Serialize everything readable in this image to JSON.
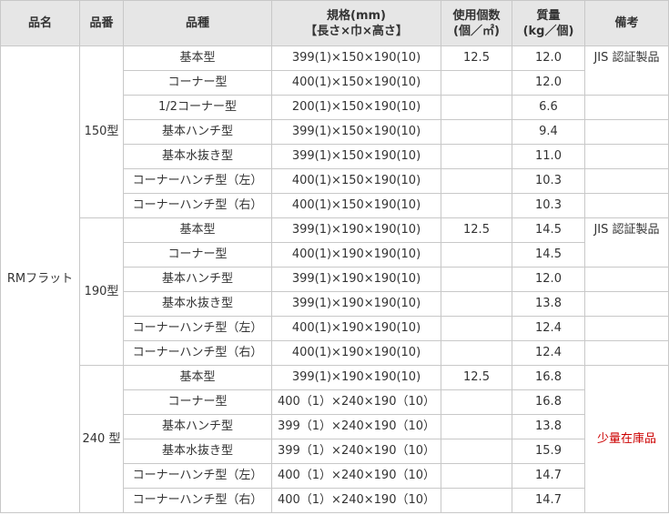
{
  "headers": {
    "name": "品名",
    "number": "品番",
    "type": "品種",
    "spec_line1": "規格(mm)",
    "spec_line2": "【長さ×巾×高さ】",
    "usage_line1": "使用個数",
    "usage_line2": "(個／㎡)",
    "weight_line1": "質量",
    "weight_line2": "(kg／個)",
    "remarks": "備考"
  },
  "product_name": "RMフラット",
  "groups": [
    {
      "number": "150型",
      "usage": "12.5",
      "remark": "JIS 認証製品",
      "rows": [
        {
          "type": "基本型",
          "spec": "399(1)×150×190(10)",
          "weight": "12.0"
        },
        {
          "type": "コーナー型",
          "spec": "400(1)×150×190(10)",
          "weight": "12.0"
        },
        {
          "type": "1/2コーナー型",
          "spec": "200(1)×150×190(10)",
          "weight": "6.6"
        },
        {
          "type": "基本ハンチ型",
          "spec": "399(1)×150×190(10)",
          "weight": "9.4"
        },
        {
          "type": "基本水抜き型",
          "spec": "399(1)×150×190(10)",
          "weight": "11.0"
        },
        {
          "type": "コーナーハンチ型（左）",
          "spec": "400(1)×150×190(10)",
          "weight": "10.3"
        },
        {
          "type": "コーナーハンチ型（右）",
          "spec": "400(1)×150×190(10)",
          "weight": "10.3"
        }
      ]
    },
    {
      "number": "190型",
      "usage": "12.5",
      "remark": "JIS 認証製品",
      "rows": [
        {
          "type": "基本型",
          "spec": "399(1)×190×190(10)",
          "weight": "14.5"
        },
        {
          "type": "コーナー型",
          "spec": "400(1)×190×190(10)",
          "weight": "14.5"
        },
        {
          "type": "基本ハンチ型",
          "spec": "399(1)×190×190(10)",
          "weight": "12.0"
        },
        {
          "type": "基本水抜き型",
          "spec": "399(1)×190×190(10)",
          "weight": "13.8"
        },
        {
          "type": "コーナーハンチ型（左）",
          "spec": "400(1)×190×190(10)",
          "weight": "12.4"
        },
        {
          "type": "コーナーハンチ型（右）",
          "spec": "400(1)×190×190(10)",
          "weight": "12.4"
        }
      ]
    },
    {
      "number": "240 型",
      "usage": "12.5",
      "remark": "少量在庫品",
      "remark_color": "#cc0000",
      "rows": [
        {
          "type": "基本型",
          "spec": "399(1)×190×190(10)",
          "weight": "16.8"
        },
        {
          "type": "コーナー型",
          "spec": "400（1）×240×190（10）",
          "weight": "16.8"
        },
        {
          "type": "基本ハンチ型",
          "spec": "399（1）×240×190（10）",
          "weight": "13.8"
        },
        {
          "type": "基本水抜き型",
          "spec": "399（1）×240×190（10）",
          "weight": "15.9"
        },
        {
          "type": "コーナーハンチ型（左）",
          "spec": "400（1）×240×190（10）",
          "weight": "14.7"
        },
        {
          "type": "コーナーハンチ型（右）",
          "spec": "400（1）×240×190（10）",
          "weight": "14.7"
        }
      ]
    }
  ]
}
